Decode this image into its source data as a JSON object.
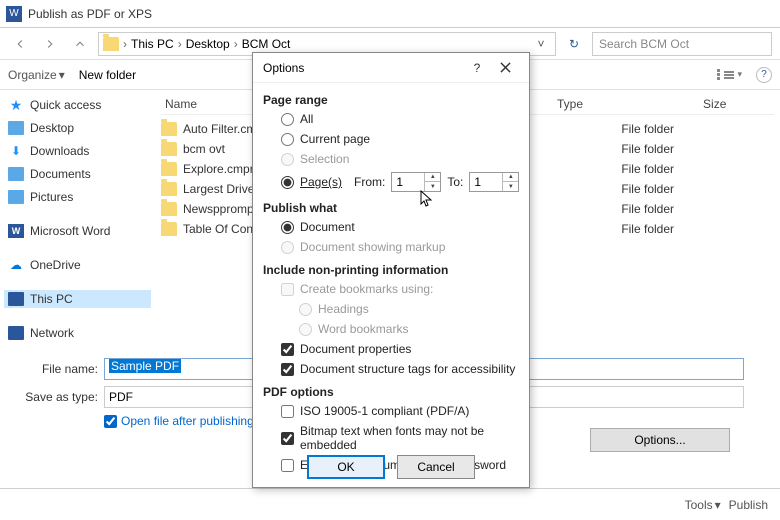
{
  "window": {
    "title": "Publish as PDF or XPS"
  },
  "breadcrumbs": {
    "root_icon": "folder",
    "seg1": "This PC",
    "seg2": "Desktop",
    "seg3": "BCM Oct"
  },
  "search": {
    "placeholder": "Search BCM Oct"
  },
  "toolbar": {
    "organize": "Organize",
    "new_folder": "New folder"
  },
  "columns": {
    "name": "Name",
    "type": "Type",
    "size": "Size"
  },
  "tree": {
    "quick_access": "Quick access",
    "desktop": "Desktop",
    "downloads": "Downloads",
    "documents": "Documents",
    "pictures": "Pictures",
    "word": "Microsoft Word",
    "onedrive": "OneDrive",
    "this_pc": "This PC",
    "network": "Network"
  },
  "files": [
    {
      "name": "Auto Filter.cm…",
      "type": "File folder"
    },
    {
      "name": "bcm ovt",
      "type": "File folder"
    },
    {
      "name": "Explore.cmpro…",
      "type": "File folder"
    },
    {
      "name": "Largest Drive F…",
      "type": "File folder"
    },
    {
      "name": "Newspprompt…",
      "type": "File folder"
    },
    {
      "name": "Table Of Conte…",
      "type": "File folder"
    }
  ],
  "save": {
    "file_name_label": "File name:",
    "file_name_value": "Sample PDF",
    "save_as_type_label": "Save as type:",
    "save_as_type_value": "PDF",
    "open_after_label": "Open file after publishing",
    "options_button": "Options...",
    "tools_label": "Tools",
    "publish_label": "Publish"
  },
  "options": {
    "title": "Options",
    "page_range_hd": "Page range",
    "all": "All",
    "current_page": "Current page",
    "selection": "Selection",
    "pages": "Page(s)",
    "from_label": "From:",
    "from_value": "1",
    "to_label": "To:",
    "to_value": "1",
    "publish_what_hd": "Publish what",
    "document": "Document",
    "doc_markup": "Document showing markup",
    "include_hd": "Include non-printing information",
    "create_bookmarks": "Create bookmarks using:",
    "headings": "Headings",
    "word_bookmarks": "Word bookmarks",
    "doc_props": "Document properties",
    "doc_struct": "Document structure tags for accessibility",
    "pdf_options_hd": "PDF options",
    "iso": "ISO 19005-1 compliant (PDF/A)",
    "bitmap": "Bitmap text when fonts may not be embedded",
    "encrypt": "Encrypt the document with a password",
    "ok": "OK",
    "cancel": "Cancel"
  }
}
